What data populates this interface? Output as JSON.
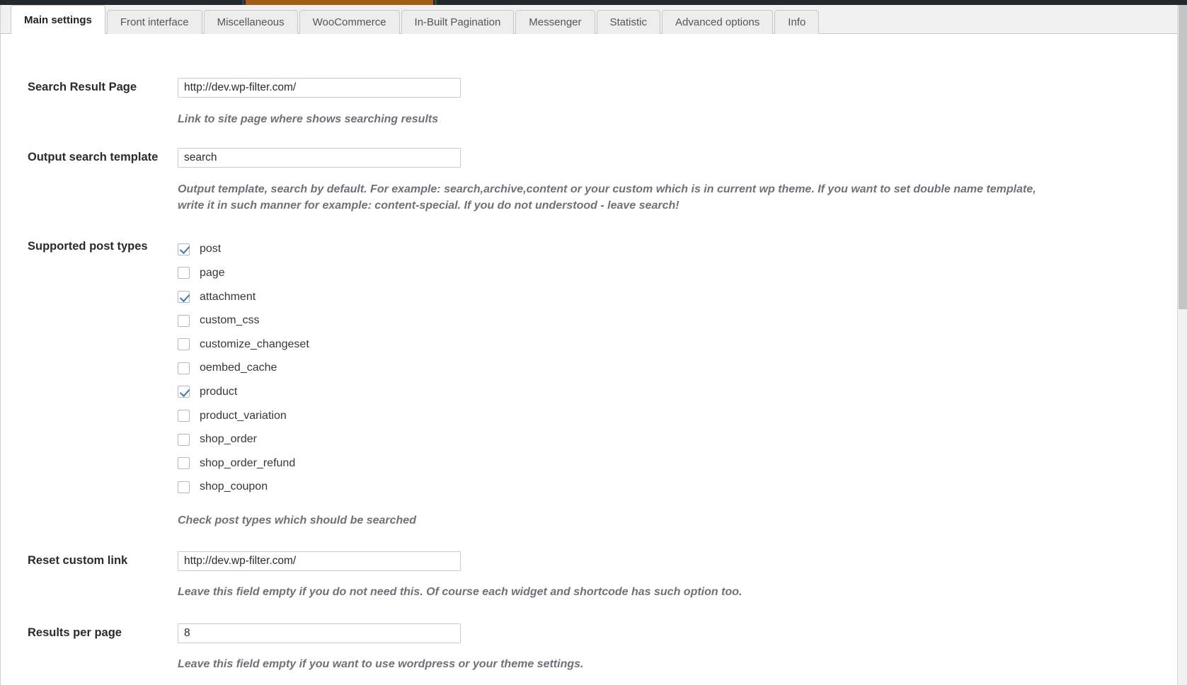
{
  "admin_bar": {
    "background_color": "#23282d",
    "accent_color": "#a35d16"
  },
  "tabs": [
    {
      "label": "Main settings",
      "active": true
    },
    {
      "label": "Front interface",
      "active": false
    },
    {
      "label": "Miscellaneous",
      "active": false
    },
    {
      "label": "WooCommerce",
      "active": false
    },
    {
      "label": "In-Built Pagination",
      "active": false
    },
    {
      "label": "Messenger",
      "active": false
    },
    {
      "label": "Statistic",
      "active": false
    },
    {
      "label": "Advanced options",
      "active": false
    },
    {
      "label": "Info",
      "active": false
    }
  ],
  "fields": {
    "search_result_page": {
      "label": "Search Result Page",
      "value": "http://dev.wp-filter.com/",
      "placeholder": "",
      "description": "Link to site page where shows searching results"
    },
    "output_search_template": {
      "label": "Output search template",
      "value": "search",
      "placeholder": "",
      "description": "Output template, search by default. For example: search,archive,content or your custom which is in current wp theme. If you want to set double name template, write it in such manner for example: content-special. If you do not understood - leave search!"
    },
    "supported_post_types": {
      "label": "Supported post types",
      "description": "Check post types which should be searched",
      "options": [
        {
          "label": "post",
          "checked": true
        },
        {
          "label": "page",
          "checked": false
        },
        {
          "label": "attachment",
          "checked": true
        },
        {
          "label": "custom_css",
          "checked": false
        },
        {
          "label": "customize_changeset",
          "checked": false
        },
        {
          "label": "oembed_cache",
          "checked": false
        },
        {
          "label": "product",
          "checked": true
        },
        {
          "label": "product_variation",
          "checked": false
        },
        {
          "label": "shop_order",
          "checked": false
        },
        {
          "label": "shop_order_refund",
          "checked": false
        },
        {
          "label": "shop_coupon",
          "checked": false
        }
      ]
    },
    "reset_custom_link": {
      "label": "Reset custom link",
      "value": "http://dev.wp-filter.com/",
      "placeholder": "",
      "description": "Leave this field empty if you do not need this. Of course each widget and shortcode has such option too."
    },
    "results_per_page": {
      "label": "Results per page",
      "value": "8",
      "placeholder": "",
      "description": "Leave this field empty if you want to use wordpress or your theme settings."
    }
  },
  "colors": {
    "checkbox_check": "#3e7ca6",
    "description_text": "#6e7276",
    "label_text": "#2b2b2b",
    "tab_active_bg": "#ffffff",
    "tab_inactive_bg": "#ededed"
  }
}
